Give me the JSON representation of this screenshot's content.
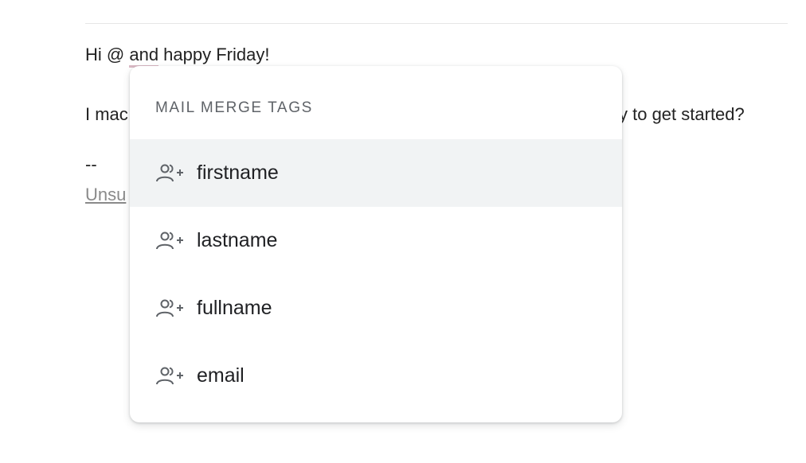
{
  "email": {
    "line1_prefix": "Hi @ ",
    "line1_word": "and",
    "line1_suffix": " happy Friday!",
    "line2_start": "I mac",
    "line2_end": "y to get started?",
    "line3": "--",
    "unsubscribe_partial": "Unsu"
  },
  "popup": {
    "header": "MAIL MERGE TAGS",
    "items": [
      {
        "label": "firstname",
        "icon": "person-add-icon",
        "active": true
      },
      {
        "label": "lastname",
        "icon": "person-add-icon",
        "active": false
      },
      {
        "label": "fullname",
        "icon": "person-add-icon",
        "active": false
      },
      {
        "label": "email",
        "icon": "person-add-icon",
        "active": false
      }
    ]
  },
  "colors": {
    "highlight": "#f1f3f4",
    "spell_underline": "#d9b8c4",
    "header_text": "#5f6368"
  }
}
